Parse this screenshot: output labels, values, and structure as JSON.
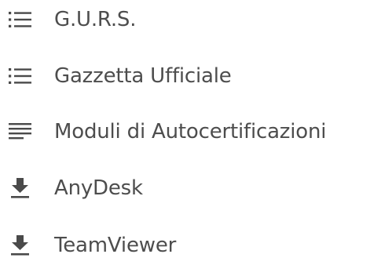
{
  "menu": {
    "items": [
      {
        "label": "G.U.R.S.",
        "icon": "list-bulleted-icon"
      },
      {
        "label": "Gazzetta Ufficiale",
        "icon": "list-bulleted-icon"
      },
      {
        "label": "Moduli di Autocertificazioni",
        "icon": "text-lines-icon"
      },
      {
        "label": "AnyDesk",
        "icon": "download-icon"
      },
      {
        "label": "TeamViewer",
        "icon": "download-icon"
      }
    ]
  },
  "colors": {
    "text": "#4d4d4d",
    "icon": "#4a4a4a",
    "background": "#ffffff"
  }
}
